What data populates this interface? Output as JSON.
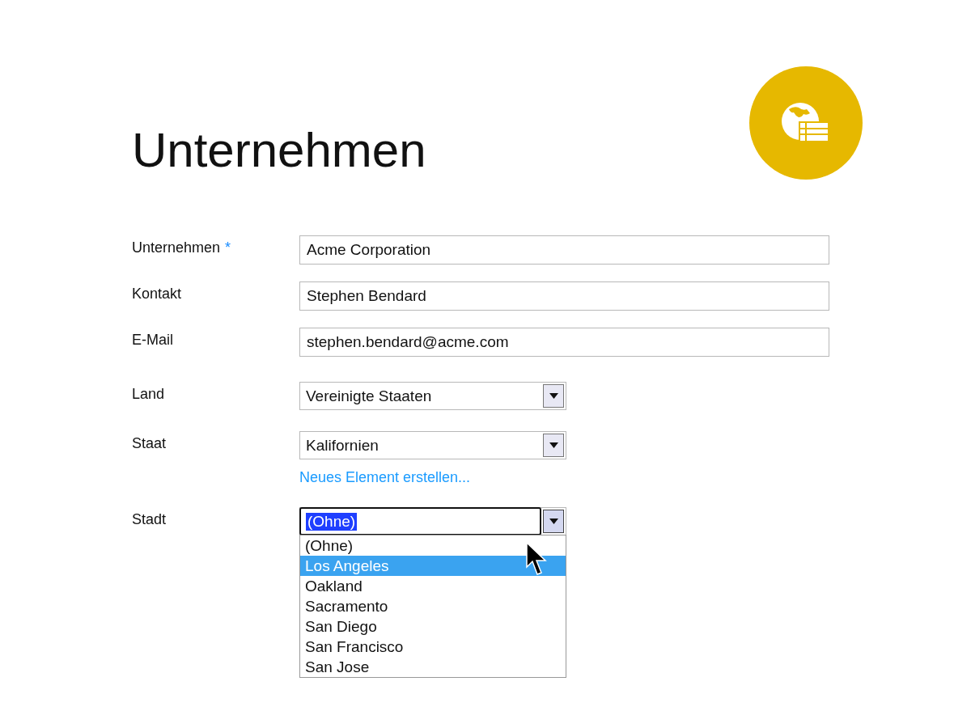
{
  "header": {
    "title": "Unternehmen"
  },
  "fields": [
    {
      "kind": "text",
      "label": "Unternehmen",
      "required_mark": "*",
      "value": "Acme Corporation"
    },
    {
      "kind": "text",
      "label": "Kontakt",
      "value": "Stephen Bendard"
    },
    {
      "kind": "text",
      "label": "E-Mail",
      "value": "stephen.bendard@acme.com"
    },
    {
      "kind": "select",
      "label": "Land",
      "value": "Vereinigte Staaten",
      "focused": false,
      "expanded": false
    },
    {
      "kind": "select",
      "label": "Staat",
      "value": "Kalifornien",
      "focused": false,
      "expanded": false,
      "link": "Neues Element erstellen..."
    },
    {
      "kind": "select",
      "label": "Stadt",
      "value": "(Ohne)",
      "focused": true,
      "expanded": true,
      "options": [
        {
          "label": "(Ohne)",
          "highlighted": false
        },
        {
          "label": "Los Angeles",
          "highlighted": true
        },
        {
          "label": "Oakland",
          "highlighted": false
        },
        {
          "label": "Sacramento",
          "highlighted": false
        },
        {
          "label": "San Diego",
          "highlighted": false
        },
        {
          "label": "San Francisco",
          "highlighted": false
        },
        {
          "label": "San Jose",
          "highlighted": false
        }
      ]
    }
  ]
}
